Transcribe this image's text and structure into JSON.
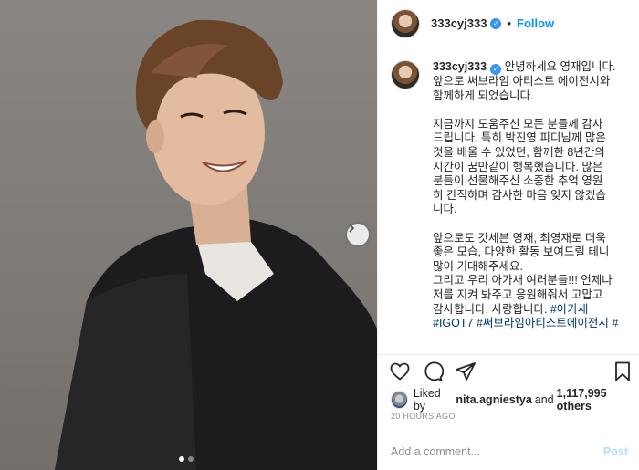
{
  "post": {
    "username": "333cyj333",
    "follow_label": "Follow",
    "separator": "•",
    "caption_lines": [
      "안녕하세요 영재입니다.",
      "앞으로 써브라임 아티스트 에이전시와",
      "함께하게 되었습니다.",
      "",
      "지금까지 도움주신 모든 분들께 감사",
      "드립니다. 특히 박진영 피디님께 많은",
      "것을 배울 수 있었던, 함께한 8년간의",
      "시간이 꿈만같이 행복했습니다. 많은",
      "분들이 선물해주신 소중한 추억 영원",
      "히 간직하며 감사한 마음 잊지 않겠습",
      "니다.",
      "",
      "앞으로도 갓세븐 영재, 최영재로 더욱",
      "좋은 모습, 다양한 활동 보여드릴 테니",
      "많이 기대해주세요.",
      "그리고 우리 아가새 여러분들!!! 언제나",
      "저를 지켜 봐주고 응원해줘서 고맙고",
      "감사합니다. 사랑합니다."
    ],
    "hashtags": [
      "#아가새",
      "#IGOT7",
      "#써브라임아티스트에이전시",
      "#"
    ],
    "likes_prefix": "Liked by ",
    "liked_by_user": "nita.agniestya",
    "likes_middle": " and ",
    "likes_count": "1,117,995 others",
    "timestamp": "20 HOURS AGO",
    "comment_placeholder": "Add a comment...",
    "post_label": "Post"
  },
  "carousel": {
    "total": 2,
    "current": 1
  },
  "icons": {
    "like": "heart-icon",
    "comment": "comment-icon",
    "share": "paper-plane-icon",
    "save": "bookmark-icon",
    "next": "chevron-right-icon",
    "verified": "verified-badge-icon"
  },
  "colors": {
    "link_blue": "#0095f6",
    "hashtag": "#00376b",
    "verified": "#3897f0",
    "muted": "#8e8e8e"
  }
}
